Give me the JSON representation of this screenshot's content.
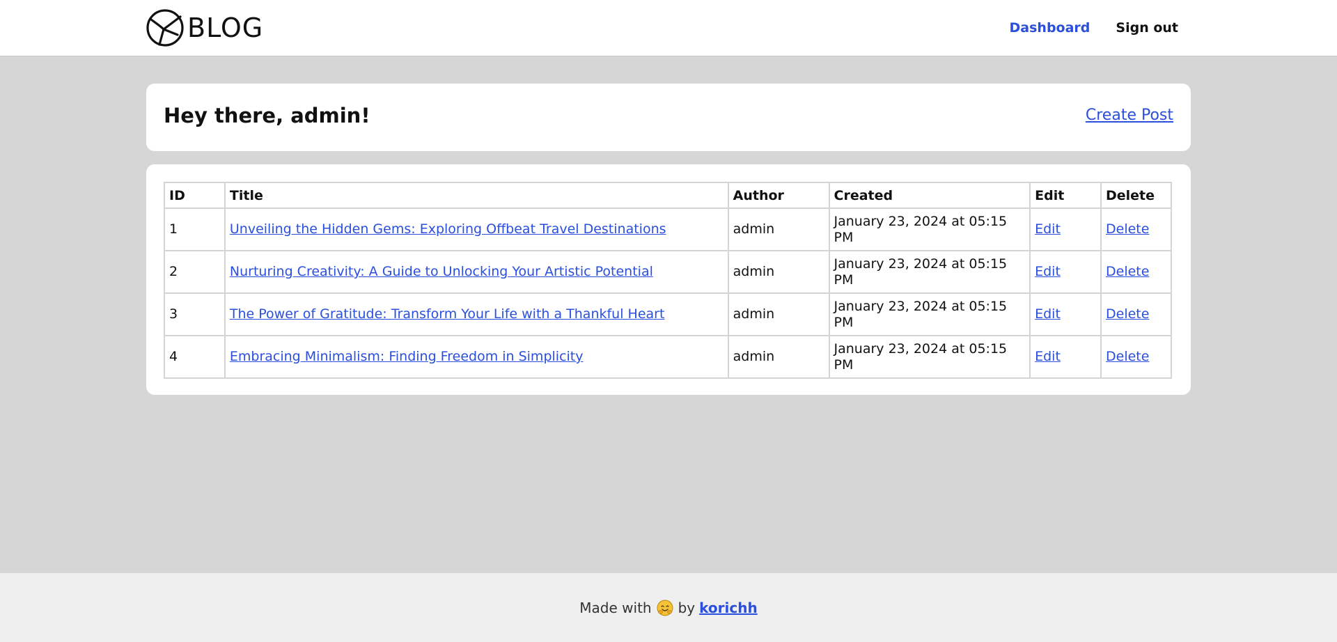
{
  "brand": {
    "name": "BLOG",
    "icon": "plane-circle-logo"
  },
  "nav": {
    "dashboard": "Dashboard",
    "sign_out": "Sign out"
  },
  "greeting": {
    "title": "Hey there, admin!",
    "create_post": "Create Post"
  },
  "table": {
    "headers": [
      "ID",
      "Title",
      "Author",
      "Created",
      "Edit",
      "Delete"
    ],
    "rows": [
      {
        "id": "1",
        "title": "Unveiling the Hidden Gems: Exploring Offbeat Travel Destinations",
        "author": "admin",
        "created": "January 23, 2024 at 05:15 PM",
        "edit": "Edit",
        "delete": "Delete"
      },
      {
        "id": "2",
        "title": "Nurturing Creativity: A Guide to Unlocking Your Artistic Potential",
        "author": "admin",
        "created": "January 23, 2024 at 05:15 PM",
        "edit": "Edit",
        "delete": "Delete"
      },
      {
        "id": "3",
        "title": "The Power of Gratitude: Transform Your Life with a Thankful Heart",
        "author": "admin",
        "created": "January 23, 2024 at 05:15 PM",
        "edit": "Edit",
        "delete": "Delete"
      },
      {
        "id": "4",
        "title": "Embracing Minimalism: Finding Freedom in Simplicity",
        "author": "admin",
        "created": "January 23, 2024 at 05:15 PM",
        "edit": "Edit",
        "delete": "Delete"
      }
    ]
  },
  "footer": {
    "made_with": "Made with",
    "emoji": "hugging-face-emoji",
    "by": "by",
    "author_link": "korichh"
  },
  "colors": {
    "accent": "#2a4fdc",
    "page_bg": "#d6d6d6",
    "footer_bg": "#efefef"
  }
}
